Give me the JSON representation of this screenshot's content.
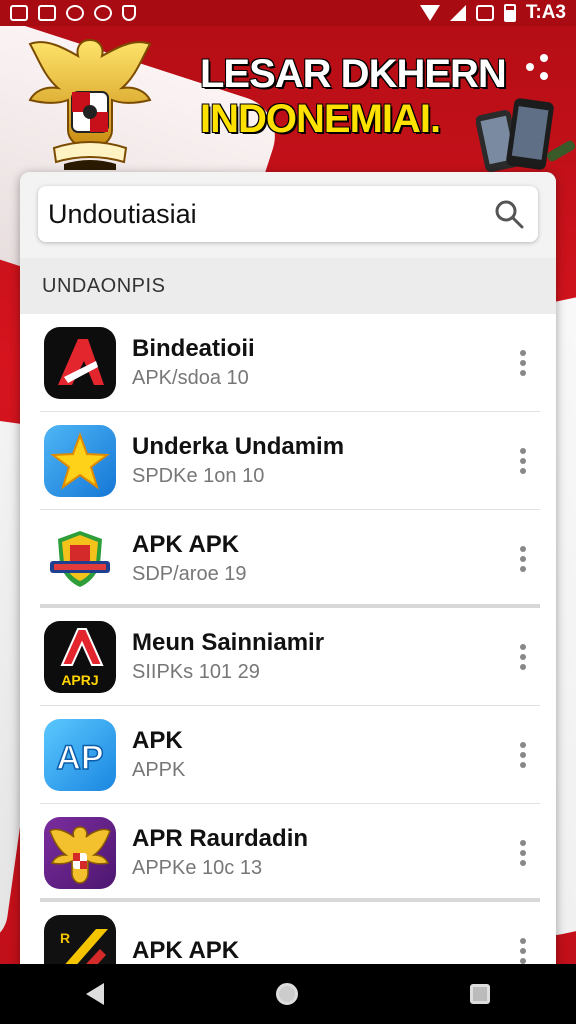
{
  "status_bar": {
    "time": "T:A3",
    "left_icons": [
      "gallery-icon",
      "image-icon",
      "clock-icon",
      "chat-icon",
      "shield-icon"
    ],
    "right_icons": [
      "wifi-icon",
      "signal-icon",
      "no-sim-icon",
      "battery-icon"
    ]
  },
  "banner": {
    "line1": "LESAR DKHERN",
    "line2": "INDONEMIAI.",
    "emblem_caption": "GARUDA"
  },
  "search": {
    "value": "Undoutiasiai",
    "placeholder": ""
  },
  "section_header": "UNDAONPIS",
  "apps": [
    {
      "name": "Bindeatioii",
      "sub": "APK/sdoa 10",
      "icon": "red-a-logo-icon"
    },
    {
      "name": "Underka Undamim",
      "sub": "SPDKe 1on 10",
      "icon": "star-icon"
    },
    {
      "name": "APK APK",
      "sub": "SDP/aroe 19",
      "icon": "shield-badge-icon"
    },
    {
      "name": "Meun Sainniamir",
      "sub": "SIIPKs 101 29",
      "icon": "red-a-apk-icon",
      "icon_text": "APRJ"
    },
    {
      "name": "APK",
      "sub": "APPK",
      "icon": "blue-apk-icon",
      "icon_text": "AP"
    },
    {
      "name": "APR Raurdadin",
      "sub": "APPKe 10c 13",
      "icon": "garuda-icon"
    },
    {
      "name": "APK APK",
      "sub": "",
      "icon": "yellow-slash-icon",
      "icon_text": "R"
    }
  ],
  "nav": {
    "icons": [
      "back-icon",
      "home-icon",
      "recents-icon"
    ]
  },
  "colors": {
    "brand_red": "#c8101a",
    "banner_yellow": "#ffe100"
  }
}
